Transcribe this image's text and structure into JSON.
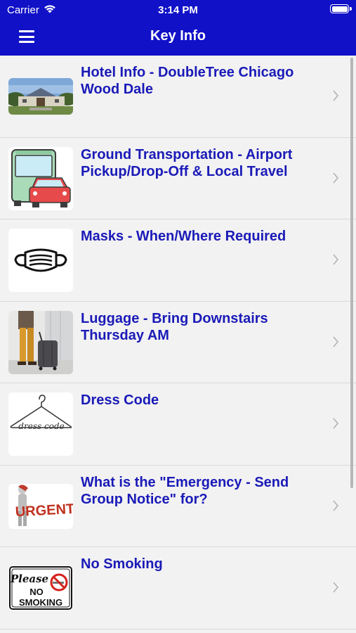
{
  "status_bar": {
    "carrier": "Carrier",
    "time": "3:14 PM"
  },
  "header": {
    "title": "Key Info",
    "menu_icon": "hamburger-menu-icon"
  },
  "items": [
    {
      "label": "Hotel Info - DoubleTree Chicago Wood Dale",
      "image": "hotel-photo"
    },
    {
      "label": "Ground Transportation - Airport Pickup/Drop-Off & Local Travel",
      "image": "bus-and-car-icon"
    },
    {
      "label": "Masks - When/Where Required",
      "image": "face-mask-icon"
    },
    {
      "label": "Luggage - Bring Downstairs Thursday AM",
      "image": "luggage-photo"
    },
    {
      "label": "Dress Code",
      "image": "hanger-icon"
    },
    {
      "label": "What is the \"Emergency - Send Group Notice\" for?",
      "image": "urgent-icon"
    },
    {
      "label": "No Smoking",
      "image": "no-smoking-sign"
    }
  ],
  "sign_text": {
    "dress_code": "dress code",
    "urgent": "URGENT",
    "please": "Please",
    "no": "NO",
    "smoking": "SMOKING"
  },
  "colors": {
    "header_bg": "#1111c8",
    "link_text": "#1a1ab8",
    "background": "#f2f2f2"
  }
}
